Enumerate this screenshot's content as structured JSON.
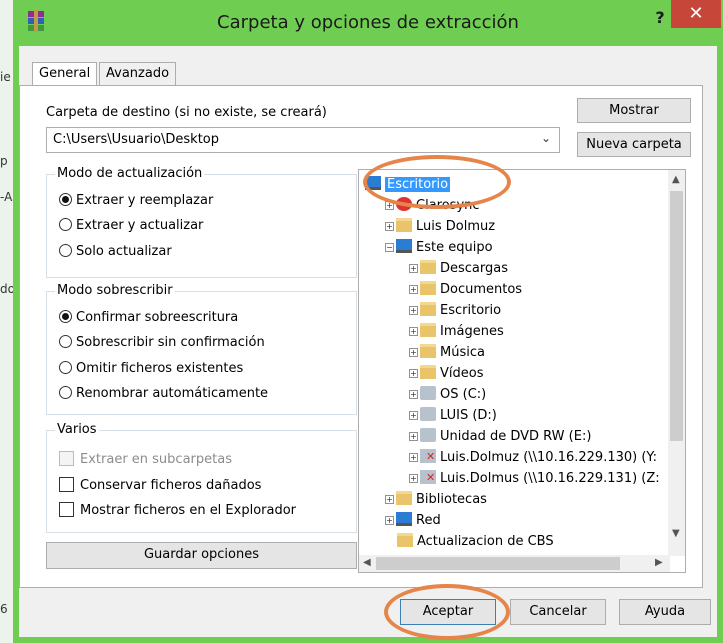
{
  "window": {
    "title": "Carpeta y opciones de extracción",
    "help_label": "?",
    "close_label": "✕"
  },
  "background": {
    "marks": [
      "ie",
      "p",
      "-A",
      "do",
      "6"
    ]
  },
  "tabs": [
    "General",
    "Avanzado"
  ],
  "destination": {
    "label": "Carpeta de destino (si no existe, se creará)",
    "value": "C:\\Users\\Usuario\\Desktop",
    "show_button": "Mostrar",
    "new_folder_button": "Nueva carpeta"
  },
  "update_mode": {
    "title": "Modo de actualización",
    "options": [
      "Extraer y reemplazar",
      "Extraer y actualizar",
      "Solo actualizar"
    ],
    "selected": 0
  },
  "overwrite_mode": {
    "title": "Modo sobrescribir",
    "options": [
      "Confirmar sobreescritura",
      "Sobrescribir sin confirmación",
      "Omitir ficheros existentes",
      "Renombrar automáticamente"
    ],
    "selected": 0
  },
  "misc": {
    "title": "Varios",
    "options": [
      {
        "label": "Extraer en subcarpetas",
        "checked": false,
        "disabled": true
      },
      {
        "label": "Conservar ficheros dañados",
        "checked": false,
        "disabled": false
      },
      {
        "label": "Mostrar ficheros en el Explorador",
        "checked": false,
        "disabled": false
      }
    ]
  },
  "save_options_button": "Guardar opciones",
  "tree": {
    "nodes": [
      {
        "label": "Escritorio",
        "level": 0,
        "icon": "monitor-icon",
        "selected": true,
        "expander": ""
      },
      {
        "label": "Clarosync",
        "level": 1,
        "icon": "clarosync-icon",
        "expander": "+"
      },
      {
        "label": "Luis Dolmuz",
        "level": 1,
        "icon": "user-folder-icon",
        "expander": "+"
      },
      {
        "label": "Este equipo",
        "level": 1,
        "icon": "computer-icon",
        "expander": "-"
      },
      {
        "label": "Descargas",
        "level": 2,
        "icon": "folder-icon",
        "expander": "+"
      },
      {
        "label": "Documentos",
        "level": 2,
        "icon": "folder-icon",
        "expander": "+"
      },
      {
        "label": "Escritorio",
        "level": 2,
        "icon": "folder-icon",
        "expander": "+"
      },
      {
        "label": "Imágenes",
        "level": 2,
        "icon": "folder-icon",
        "expander": "+"
      },
      {
        "label": "Música",
        "level": 2,
        "icon": "folder-icon",
        "expander": "+"
      },
      {
        "label": "Vídeos",
        "level": 2,
        "icon": "folder-icon",
        "expander": "+"
      },
      {
        "label": "OS (C:)",
        "level": 2,
        "icon": "drive-icon",
        "expander": "+"
      },
      {
        "label": "LUIS (D:)",
        "level": 2,
        "icon": "drive-icon",
        "expander": "+"
      },
      {
        "label": "Unidad de DVD RW (E:)",
        "level": 2,
        "icon": "dvd-drive-icon",
        "expander": "+"
      },
      {
        "label": "Luis.Dolmuz (\\\\10.16.229.130) (Y:",
        "level": 2,
        "icon": "network-drive-icon",
        "expander": "+"
      },
      {
        "label": "Luis.Dolmus (\\\\10.16.229.131) (Z:",
        "level": 2,
        "icon": "network-drive-icon",
        "expander": "+"
      },
      {
        "label": "Bibliotecas",
        "level": 1,
        "icon": "folder-icon",
        "expander": "+"
      },
      {
        "label": "Red",
        "level": 1,
        "icon": "network-icon",
        "expander": "+"
      },
      {
        "label": "Actualizacion de CBS",
        "level": 1,
        "icon": "folder-icon",
        "expander": ""
      }
    ]
  },
  "buttons": {
    "ok": "Aceptar",
    "cancel": "Cancelar",
    "help": "Ayuda"
  },
  "colors": {
    "titlebar": "#6fce52",
    "close": "#c7463a",
    "annotation": "#e6854a",
    "selection": "#3399ff"
  }
}
